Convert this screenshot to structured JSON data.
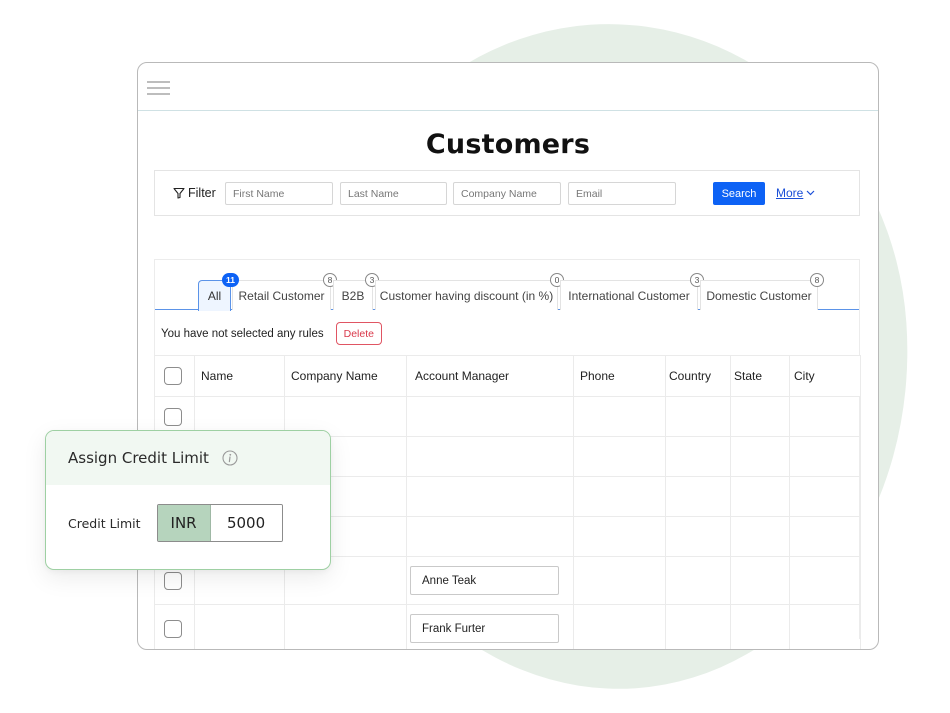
{
  "header": {
    "menu_icon": "hamburger-menu-icon",
    "title": "Customers"
  },
  "filter": {
    "label": "Filter",
    "icon": "funnel-icon",
    "fields": [
      {
        "name": "first-name",
        "placeholder": "First Name",
        "value": ""
      },
      {
        "name": "last-name",
        "placeholder": "Last Name",
        "value": ""
      },
      {
        "name": "company-name",
        "placeholder": "Company Name",
        "value": ""
      },
      {
        "name": "email",
        "placeholder": "Email",
        "value": ""
      }
    ],
    "search_label": "Search",
    "more_label": "More",
    "more_icon": "chevron-down-icon"
  },
  "tabs": [
    {
      "label": "All",
      "count": "11",
      "active": true
    },
    {
      "label": "Retail Customer",
      "count": "8",
      "active": false
    },
    {
      "label": "B2B",
      "count": "3",
      "active": false
    },
    {
      "label": "Customer having discount (in %)",
      "count": "0",
      "active": false
    },
    {
      "label": "International Customer",
      "count": "3",
      "active": false
    },
    {
      "label": "Domestic Customer",
      "count": "8",
      "active": false
    }
  ],
  "rules": {
    "status_text": "You have not selected any  rules",
    "delete_label": "Delete"
  },
  "table": {
    "columns": [
      "Name",
      "Company  Name",
      "Account Manager",
      "Phone",
      "Country",
      "State",
      "City"
    ],
    "rows": [
      {
        "account_manager": ""
      },
      {
        "account_manager": ""
      },
      {
        "account_manager": ""
      },
      {
        "account_manager": ""
      },
      {
        "account_manager": "Anne Teak"
      },
      {
        "account_manager": "Frank Furter"
      }
    ]
  },
  "credit_popup": {
    "title": "Assign Credit Limit",
    "info_icon": "info-icon",
    "field_label": "Credit Limit",
    "currency": "INR",
    "value": "5000"
  },
  "colors": {
    "primary": "#0d62f5",
    "danger": "#d9384a",
    "accent_green": "#b6d4bd",
    "background_blob": "#e6efe7"
  }
}
